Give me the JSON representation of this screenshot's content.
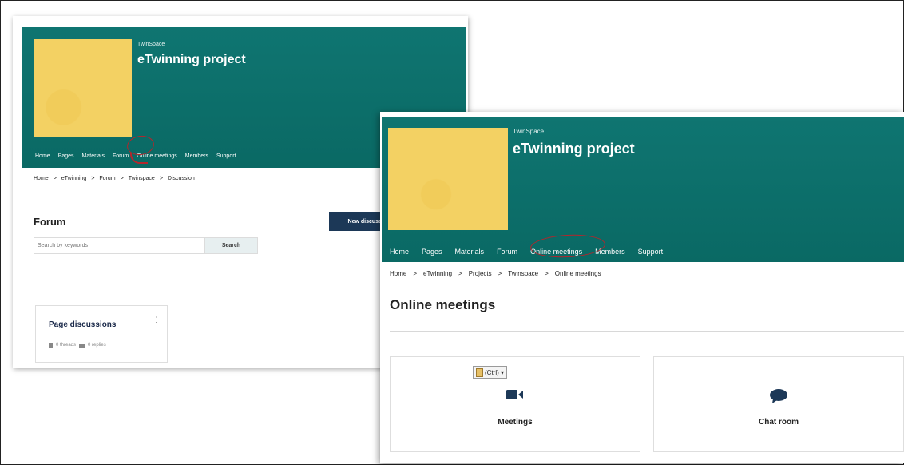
{
  "colors": {
    "banner": "#0f7571",
    "thumbnail": "#f3d163",
    "annotation": "#b3262c",
    "primary_button": "#1c3857"
  },
  "screen1": {
    "brand": "TwinSpace",
    "project_title": "eTwinning project",
    "nav": [
      "Home",
      "Pages",
      "Materials",
      "Forum",
      "Online meetings",
      "Members",
      "Support"
    ],
    "breadcrumb": [
      "Home",
      ">",
      "eTwinning",
      ">",
      "Forum",
      ">",
      "Twinspace",
      ">",
      "Discussion"
    ],
    "page_title": "Forum",
    "new_button": "New discussion",
    "search_placeholder": "Search by keywords",
    "search_button": "Search",
    "card": {
      "title": "Page discussions",
      "menu_glyph": "⋮",
      "threads": "0 threads",
      "replies": "0 replies"
    }
  },
  "screen2": {
    "brand": "TwinSpace",
    "project_title": "eTwinning project",
    "nav": [
      "Home",
      "Pages",
      "Materials",
      "Forum",
      "Online meetings",
      "Members",
      "Support"
    ],
    "breadcrumb": [
      "Home",
      ">",
      "eTwinning",
      ">",
      "Projects",
      ">",
      "Twinspace",
      ">",
      "Online meetings"
    ],
    "page_title": "Online meetings",
    "paste_tag": "(Ctrl) ▾",
    "tiles": [
      {
        "label": "Meetings",
        "icon": "video-camera-icon"
      },
      {
        "label": "Chat room",
        "icon": "chat-bubble-icon"
      }
    ]
  }
}
